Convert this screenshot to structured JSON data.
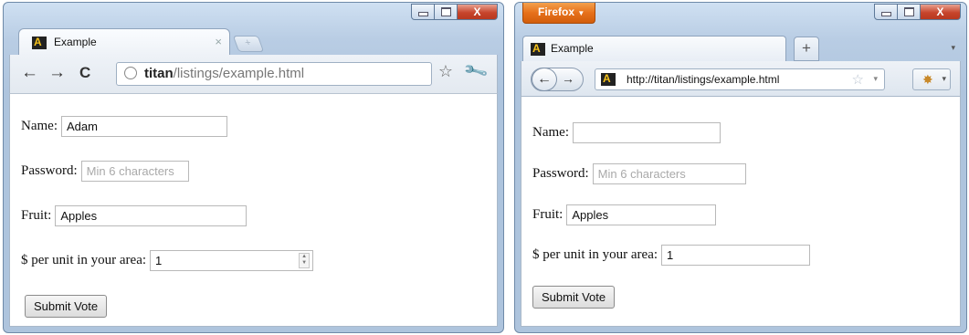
{
  "chrome": {
    "tab_title": "Example",
    "tab_close": "×",
    "new_tab": "+",
    "url_host": "titan",
    "url_path": "/listings/example.html",
    "back": "←",
    "forward": "→",
    "reload": "C",
    "star": "☆",
    "wrench": "🔧",
    "form": {
      "name_label": "Name:",
      "name_value": "Adam",
      "password_label": "Password:",
      "password_placeholder": "Min 6 characters",
      "fruit_label": "Fruit:",
      "fruit_value": "Apples",
      "price_label": "$ per unit in your area:",
      "price_value": "1",
      "submit_label": "Submit Vote"
    }
  },
  "firefox": {
    "menu_label": "Firefox",
    "menu_arrow": "▼",
    "tab_title": "Example",
    "new_tab": "+",
    "list_all": "▾",
    "back": "←",
    "forward": "→",
    "url": "http://titan/listings/example.html",
    "star": "☆",
    "dropdown": "▾",
    "form": {
      "name_label": "Name:",
      "name_value": "",
      "password_label": "Password:",
      "password_placeholder": "Min 6 characters",
      "fruit_label": "Fruit:",
      "fruit_value": "Apples",
      "price_label": "$ per unit in your area:",
      "price_value": "1",
      "submit_label": "Submit Vote"
    }
  },
  "window_controls": {
    "minimize": "—",
    "maximize": "□",
    "close": "X"
  },
  "colors": {
    "firefox_menu": "#e7711b",
    "close_button": "#c7452c",
    "frame": "#b9cde4"
  }
}
